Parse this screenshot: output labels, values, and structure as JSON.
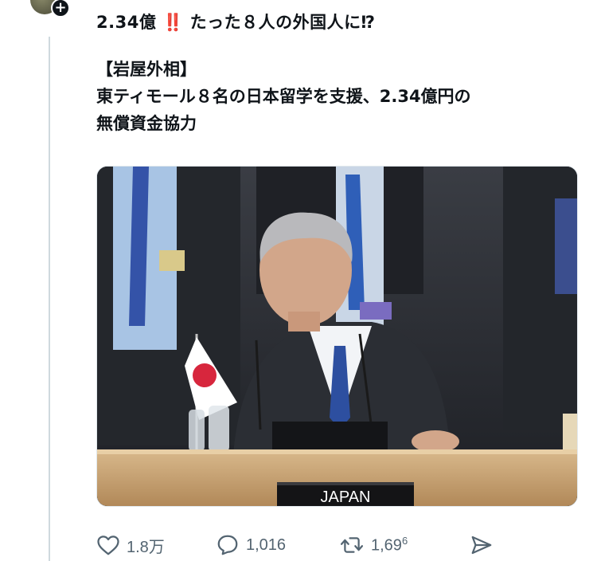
{
  "post": {
    "title_prefix": "2.34億",
    "title_emoji": "‼️",
    "title_suffix": "たった８人の外国人に⁉︎",
    "body_lines": [
      "【岩屋外相】",
      "東ティモール８名の日本留学を支援、2.34億円の",
      "無償資金協力"
    ]
  },
  "image": {
    "nameplate": "JAPAN"
  },
  "actions": {
    "likes": "1.8万",
    "replies": "1,016",
    "reposts": "1,69",
    "reposts_sup": "6"
  },
  "colors": {
    "text": "#0f1419",
    "muted": "#536471",
    "emoji_red": "#e0245e",
    "thread_line": "#cfd9de"
  }
}
